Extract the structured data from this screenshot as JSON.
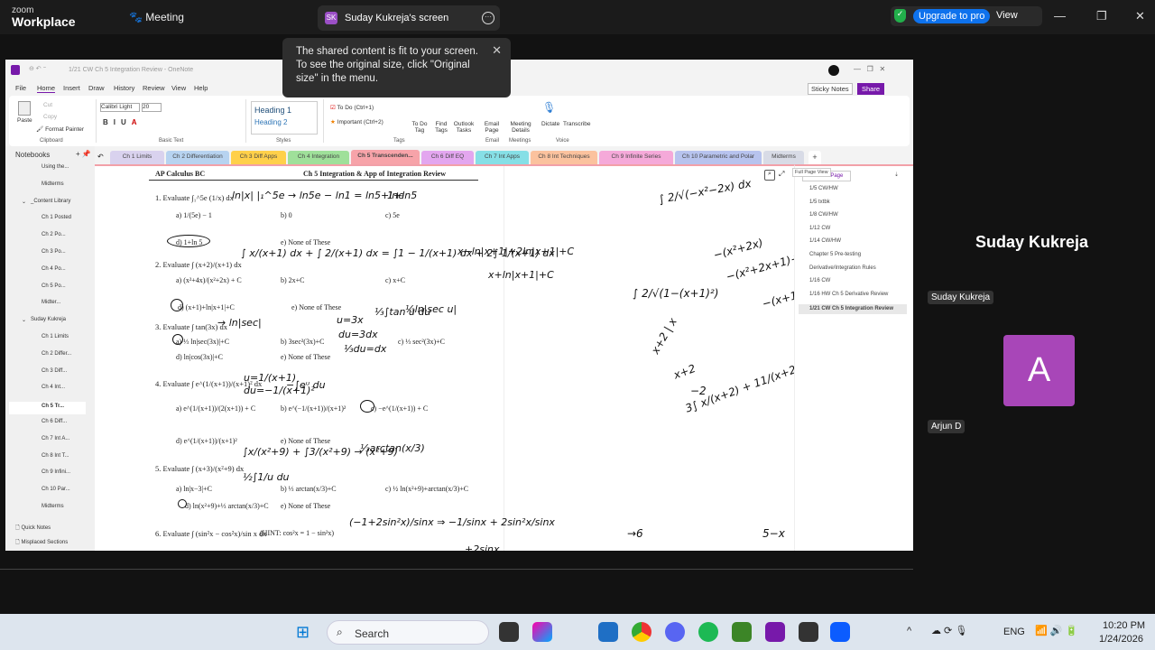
{
  "zoom": {
    "logo_top": "zoom",
    "logo_bottom": "Workplace",
    "meeting": "Meeting",
    "share_initials": "SK",
    "share_title": "Suday Kukreja's screen",
    "upgrade": "Upgrade to pro",
    "view": "View",
    "tooltip": "The shared content is fit to your screen. To see the original size, click \"Original size\" in the menu.",
    "participants": {
      "presenter_big": "Suday Kukreja",
      "presenter_label": "Suday Kukreja",
      "avatar_letter": "A",
      "second": "Arjun D"
    },
    "avatar_color": "#a846b8"
  },
  "onenote": {
    "title": "1/21 CW Ch 5 Integration Review - OneNote",
    "menu": [
      "File",
      "Home",
      "Insert",
      "Draw",
      "History",
      "Review",
      "View",
      "Help"
    ],
    "ribbon": {
      "paste": "Paste",
      "cut": "Cut",
      "copy": "Copy",
      "format_painter": "Format Painter",
      "clipboard": "Clipboard",
      "font": "Calibri Light",
      "size": "20",
      "basic_text": "Basic Text",
      "h1": "Heading 1",
      "h2": "Heading 2",
      "styles": "Styles",
      "todo": "To Do (Ctrl+1)",
      "important": "Important (Ctrl+2)",
      "tags": "Tags",
      "todo_tag": "To Do Tag",
      "find_tags": "Find Tags",
      "outlook": "Outlook Tasks",
      "email_page": "Email Page",
      "email": "Email",
      "meeting_details": "Meeting Details",
      "meetings": "Meetings",
      "dictate": "Dictate",
      "transcribe": "Transcribe",
      "voice": "Voice",
      "sticky": "Sticky Notes",
      "share": "Share"
    },
    "tabs": [
      {
        "label": "Ch 1 Limits",
        "color": "#d9d2ee"
      },
      {
        "label": "Ch 2 Differentiation",
        "color": "#b7d3f0"
      },
      {
        "label": "Ch 3 Diff Apps",
        "color": "#ffd04a"
      },
      {
        "label": "Ch 4 Integration",
        "color": "#9fe09a"
      },
      {
        "label": "Ch 5 Transcenden...",
        "color": "#f7a3a9"
      },
      {
        "label": "Ch 6 Diff EQ",
        "color": "#e3a6ef"
      },
      {
        "label": "Ch 7 Int Apps",
        "color": "#86dfe6"
      },
      {
        "label": "Ch 8 Int Techniques",
        "color": "#fbc29e"
      },
      {
        "label": "Ch 9 Infinite Series",
        "color": "#f5a9d9"
      },
      {
        "label": "Ch 10 Parametric and Polar",
        "color": "#b7c3ee"
      },
      {
        "label": "Midterms",
        "color": "#d8dbe6"
      }
    ],
    "notebooks_title": "Notebooks",
    "notebooks": [
      {
        "label": "Using the...",
        "color": "#c8a97e"
      },
      {
        "label": "Midterms",
        "color": "#999"
      },
      {
        "label": "_Content Library",
        "color": ""
      },
      {
        "label": "Ch 1 Posted",
        "color": "#7ed321"
      },
      {
        "label": "Ch 2 Po...",
        "color": "#d0021b"
      },
      {
        "label": "Ch 3 Po...",
        "color": "#a0129b"
      },
      {
        "label": "Ch 4 Po...",
        "color": "#d0021b"
      },
      {
        "label": "Ch 5 Po...",
        "color": "#a0129b"
      },
      {
        "label": "Midter...",
        "color": "#2ac7b8"
      },
      {
        "label": "Suday Kukreja",
        "color": ""
      },
      {
        "label": "Ch 1 Limits",
        "color": "#999"
      },
      {
        "label": "Ch 2 Differ...",
        "color": "#0b4fa0"
      },
      {
        "label": "Ch 3 Diff...",
        "color": "#f5b400"
      },
      {
        "label": "Ch 4 Int...",
        "color": "#138a36"
      },
      {
        "label": "Ch 5 Tr...",
        "color": "#e81123"
      },
      {
        "label": "Ch 6 Diff...",
        "color": "#a0129b"
      },
      {
        "label": "Ch 7 Int A...",
        "color": "#0ea5e9"
      },
      {
        "label": "Ch 8 Int T...",
        "color": "#f56a00"
      },
      {
        "label": "Ch 9 Infini...",
        "color": "#e0107a"
      },
      {
        "label": "Ch 10 Par...",
        "color": "#0b5fc0"
      },
      {
        "label": "Midterms",
        "color": "#999"
      }
    ],
    "quick_notes": "Quick Notes",
    "misplaced": "Misplaced Sections",
    "add_page": "Add Page",
    "full_page_view": "Full Page View",
    "pages": [
      "1/5 CW/HW",
      "1/5 txtbk",
      "1/8 CW/HW",
      "1/12 CW",
      "1/14 CW/HW",
      "Chapter 5 Pre-testing",
      "Derivative/Integration Rules",
      "1/16 CW",
      "1/16 HW Ch 5 Derivative Review",
      "1/21 CW Ch 5 Integration Review"
    ]
  },
  "worksheet": {
    "course": "AP Calculus BC",
    "title": "Ch 5 Integration & App of Integration Review",
    "lines": [
      "1. Evaluate ∫₁^5e (1/x) dx",
      "a) 1/(5e) − 1",
      "b) 0",
      "c) 5e",
      "d) 1+ln 5",
      "e) None of These",
      "2. Evaluate ∫ (x+2)/(x+1) dx",
      "a) (x²+4x)/(x²+2x) + C",
      "b) 2x+C",
      "c) x+C",
      "d) (x+1)+ln|x+1|+C",
      "e) None of These",
      "3. Evaluate ∫ tan(3x) dx",
      "a) ⅓ ln|sec(3x)|+C",
      "b) 3sec²(3x)+C",
      "c) ⅓ sec²(3x)+C",
      "d) ln|cos(3x)|+C",
      "e) None of These",
      "4. Evaluate ∫ e^(1/(x+1))/(x+1)² dx",
      "a) e^(1/(x+1))/(2(x+1)) + C",
      "b) e^(−1/(x+1))/(x+1)²",
      "c) −e^(1/(x+1)) + C",
      "d) e^(1/(x+1))/(x+1)²",
      "e) None of These",
      "5. Evaluate ∫ (x+3)/(x²+9) dx",
      "a) ln|x−3|+C",
      "b) ⅓ arctan(x/3)+C",
      "c) ½ ln(x²+9)+arctan(x/3)+C",
      "d) ln(x²+9)+⅓ arctan(x/3)+C",
      "e) None of These",
      "6. Evaluate ∫ (sin²x − cos²x)/sin x dx",
      "(HINT: cos²x = 1 − sin²x)"
    ],
    "notes": [
      "ln|x| |₁^5e → ln5e − ln1 = ln5+lne",
      "1+ln5",
      "∫ x/(x+1) dx + ∫ 2/(x+1) dx = ∫1 − 1/(x+1) dx + 2∫ 1/(x+1) dx",
      "x−ln|x+1|+2ln|x+1|+C",
      "x+ln|x+1|+C",
      "→ ln|sec|",
      "u=3x",
      "du=3dx",
      "⅓du=dx",
      "⅓∫tan u du",
      "⅓ln|sec u|",
      "u=1/(x+1)",
      "du=−1/(x+1)²",
      "−∫eᵘ du",
      "∫x/(x²+9) + ∫3/(x²+9) → (x²+9)",
      "⅓arctan(x/3)",
      "½∫1/u du",
      "(−1+2sin²x)/sinx ⇒ −1/sinx + 2sin²x/sinx",
      "+2sinx",
      "∫ 2/√(−x²−2x) dx",
      "−(x²+2x)",
      "−(x²+2x+1)+1",
      "−(x+1)²",
      "∫ 2/√(1−(x+1)²)",
      "3∫ x/(x+2) + 11/(x+2)",
      "x+2 | x",
      "x+2",
      "−2",
      "→6",
      "5−x"
    ]
  },
  "taskbar": {
    "search": "Search",
    "lang": "ENG",
    "time": "10:20 PM",
    "date": "1/24/2026"
  }
}
